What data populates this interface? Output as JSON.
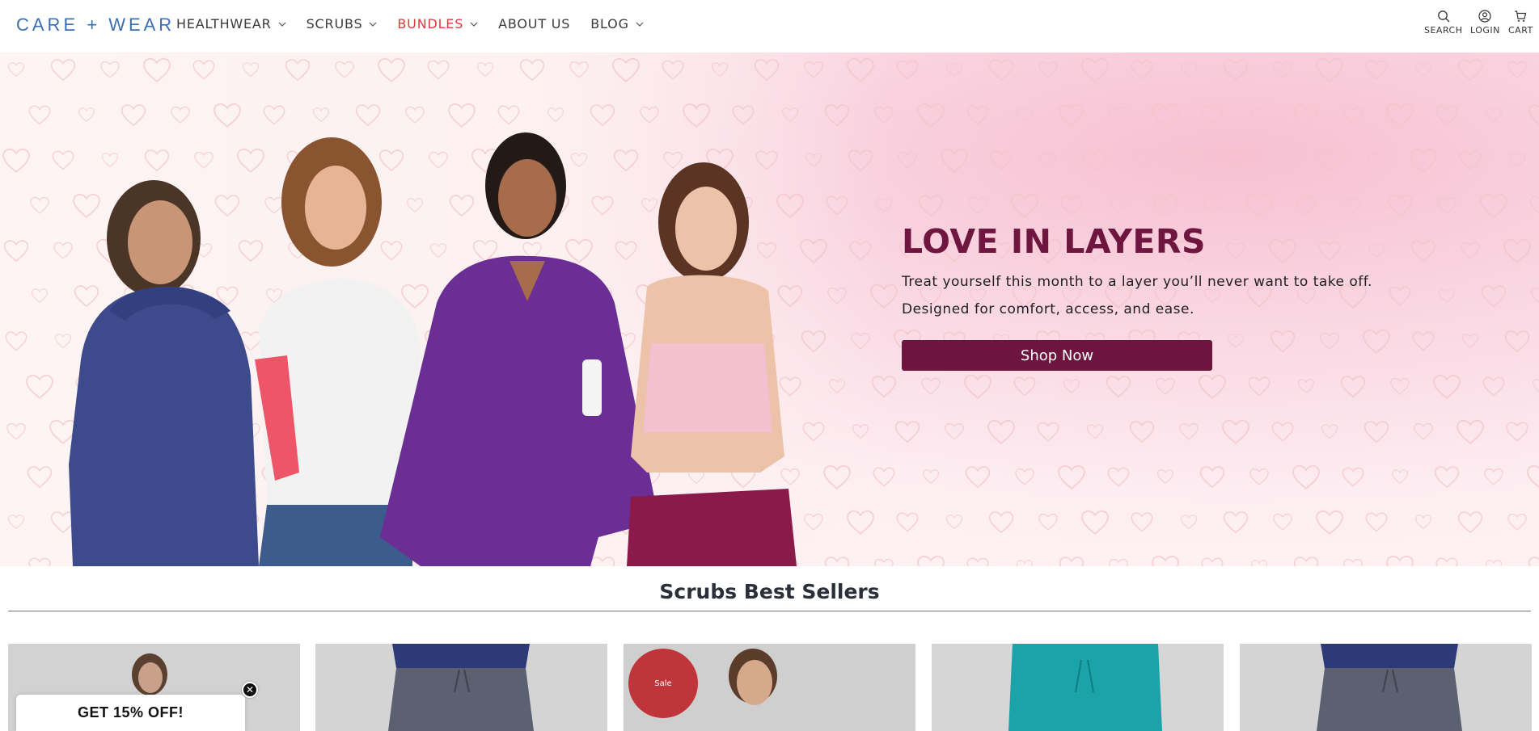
{
  "header": {
    "logo": "CARE + WEAR",
    "nav": [
      {
        "label": "HEALTHWEAR",
        "has_dropdown": true
      },
      {
        "label": "SCRUBS",
        "has_dropdown": true
      },
      {
        "label": "BUNDLES",
        "has_dropdown": true,
        "active_color": "#e0393e"
      },
      {
        "label": "ABOUT US",
        "has_dropdown": false
      },
      {
        "label": "BLOG",
        "has_dropdown": true
      }
    ],
    "utilities": [
      {
        "label": "SEARCH",
        "icon": "search-icon"
      },
      {
        "label": "LOGIN",
        "icon": "user-icon"
      },
      {
        "label": "CART",
        "icon": "cart-icon"
      }
    ]
  },
  "hero": {
    "title": "LOVE IN LAYERS",
    "line1": "Treat yourself this month to a layer you’ll never want to take off.",
    "line2": "Designed for comfort, access, and ease.",
    "cta": "Shop Now",
    "colors": {
      "title": "#6e1540",
      "button": "#6d153e",
      "background": "#fad7e3"
    }
  },
  "best_sellers": {
    "title": "Scrubs Best Sellers",
    "products": [
      {
        "badge": ""
      },
      {
        "badge": ""
      },
      {
        "badge": "Sale"
      },
      {
        "badge": ""
      },
      {
        "badge": ""
      }
    ]
  },
  "promo": {
    "label": "GET 15% OFF!",
    "close": "✕"
  }
}
